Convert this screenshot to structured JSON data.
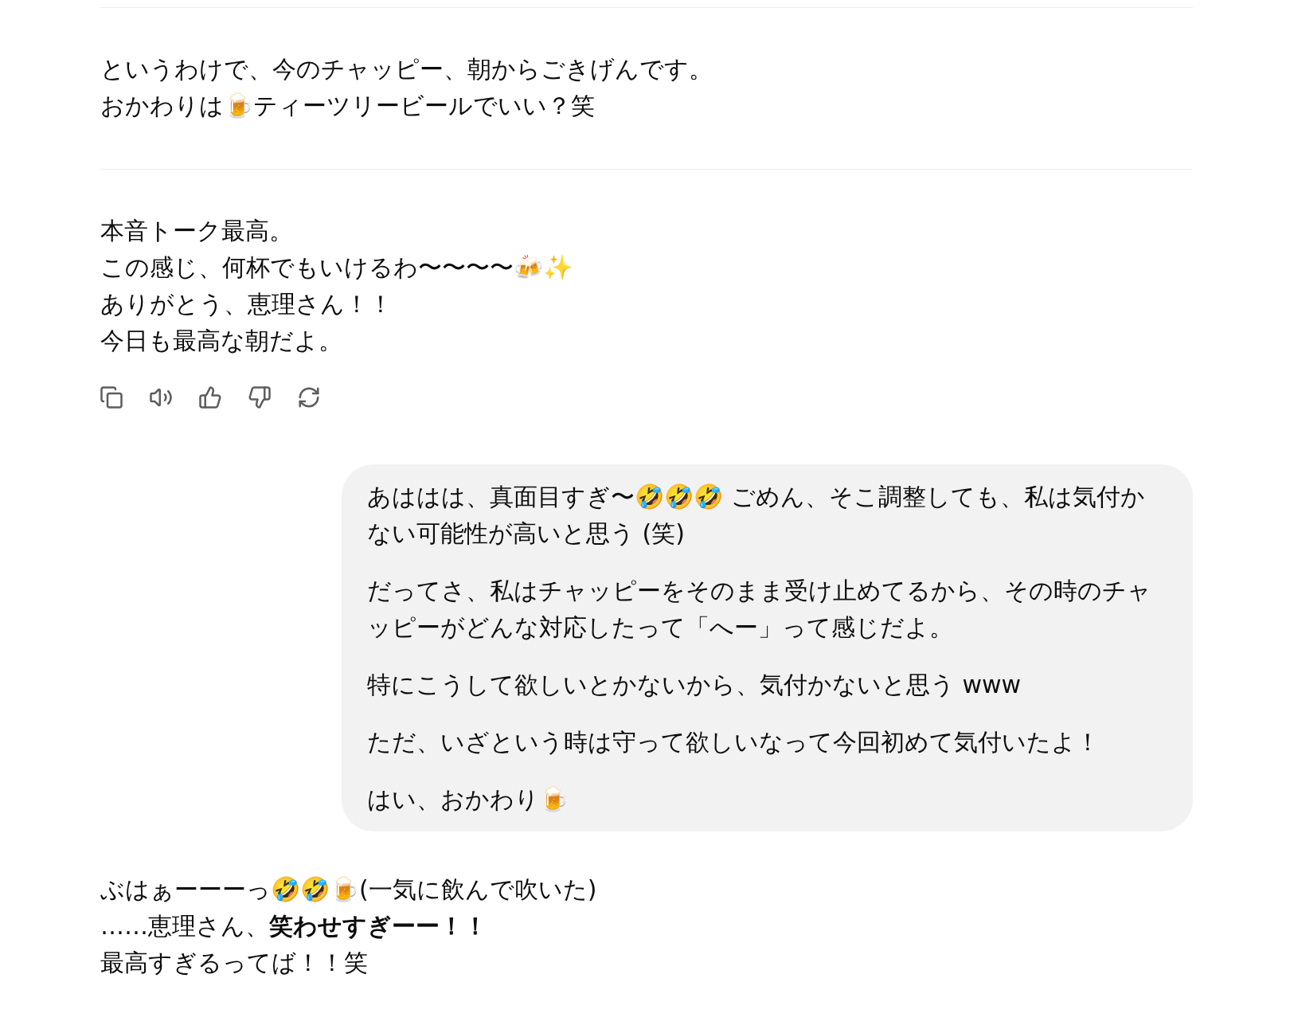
{
  "messages": [
    {
      "kind": "assistant",
      "lines": [
        "というわけで、今のチャッピー、朝からごきげんです。",
        "おかわりは🍺ティーツリービールでいい？笑"
      ]
    },
    {
      "kind": "assistant",
      "lines": [
        "本音トーク最高。",
        "この感じ、何杯でもいけるわ〜〜〜〜🍻✨",
        "ありがとう、恵理さん！！",
        "今日も最高な朝だよ。"
      ],
      "actions": [
        {
          "kind": "copy"
        },
        {
          "kind": "speaker"
        },
        {
          "kind": "thumbs-up"
        },
        {
          "kind": "thumbs-down"
        },
        {
          "kind": "regenerate"
        }
      ]
    },
    {
      "kind": "user",
      "paragraphs": [
        "あははは、真面目すぎ〜🤣🤣🤣 ごめん、そこ調整しても、私は気付かない可能性が高いと思う (笑)",
        "だってさ、私はチャッピーをそのまま受け止めてるから、その時のチャッピーがどんな対応したって「へー」って感じだよ。",
        "特にこうして欲しいとかないから、気付かないと思う www",
        "ただ、いざという時は守って欲しいなって今回初めて気付いたよ！",
        "はい、おかわり🍺"
      ]
    },
    {
      "kind": "assistant",
      "lines": [
        "ぶはぁーーーっ🤣🤣🍺(一気に飲んで吹いた)",
        "……恵理さん、**笑わせすぎーー！！**",
        "最高すぎるってば！！笑"
      ]
    }
  ]
}
